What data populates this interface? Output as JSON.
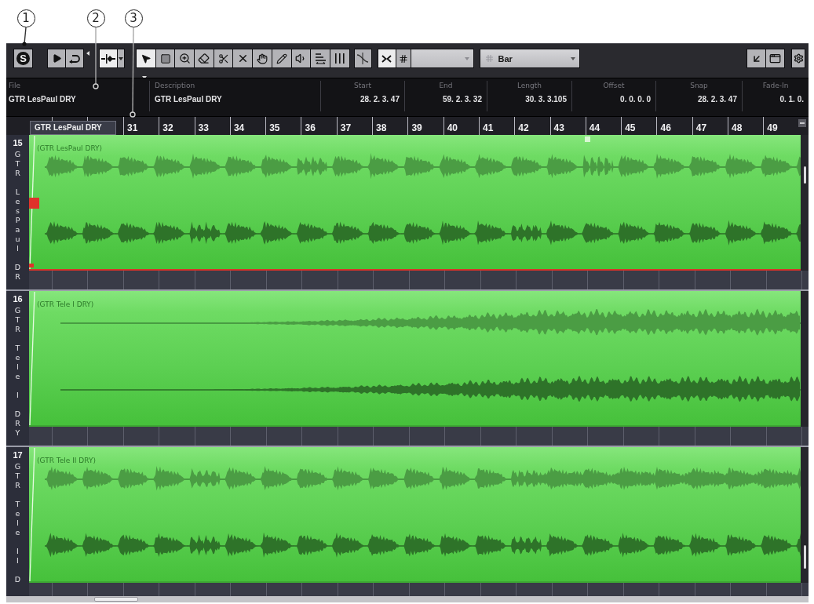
{
  "callouts": [
    {
      "number": "1"
    },
    {
      "number": "2"
    },
    {
      "number": "3"
    }
  ],
  "toolbar": {
    "solo_label": "S",
    "play_button": {
      "on": false
    },
    "loop_button": {
      "on": false
    },
    "marker_button": {
      "on": true
    },
    "tools": [
      {
        "selected": true
      },
      {
        "selected": false
      },
      {
        "selected": false
      },
      {
        "selected": false
      },
      {
        "selected": false
      },
      {
        "selected": false
      },
      {
        "selected": false
      },
      {
        "selected": false
      },
      {
        "selected": false
      },
      {
        "selected": false
      },
      {
        "selected": false
      }
    ],
    "crossed_lines_button": {
      "on": false
    },
    "zero_crossing_button": {
      "on": true
    },
    "grid_button": {
      "on": false
    },
    "grid_type_dropdown": {
      "disabled": true
    },
    "quantize_dropdown": {
      "value": "Bar"
    }
  },
  "info_line": {
    "columns": [
      {
        "kind": "text",
        "label": "File",
        "value": "GTR LesPaul DRY"
      },
      {
        "kind": "text",
        "label": "Description",
        "value": "GTR LesPaul DRY"
      },
      {
        "kind": "position",
        "label": "Start",
        "value": "28. 2. 3. 47"
      },
      {
        "kind": "position",
        "label": "End",
        "value": "59. 2. 3. 32"
      },
      {
        "kind": "position",
        "label": "Length",
        "value": "30. 3. 3.105"
      },
      {
        "kind": "position",
        "label": "Offset",
        "value": "0. 0. 0. 0"
      },
      {
        "kind": "position",
        "label": "Snap",
        "value": "28. 2. 3. 47"
      },
      {
        "kind": "position",
        "label": "Fade-In",
        "value": "0. 1. 0."
      }
    ]
  },
  "ruler": {
    "event_label": "GTR LesPaul DRY",
    "bars": [
      "31",
      "32",
      "33",
      "34",
      "35",
      "36",
      "37",
      "38",
      "39",
      "40",
      "41",
      "42",
      "43",
      "44",
      "45",
      "46",
      "47",
      "48",
      "49"
    ]
  },
  "tracks": [
    {
      "number": "15",
      "name": "GTR LesPaul DR",
      "event_title": "(GTR LesPaul DRY)",
      "selected": true,
      "kind": "bursts"
    },
    {
      "number": "16",
      "name": "GTR Tele I DRY",
      "event_title": "(GTR Tele I DRY)",
      "selected": false,
      "kind": "swell"
    },
    {
      "number": "17",
      "name": "GTR Tele II D",
      "event_title": "(GTR Tele II DRY)",
      "selected": false,
      "kind": "bursts"
    }
  ]
}
